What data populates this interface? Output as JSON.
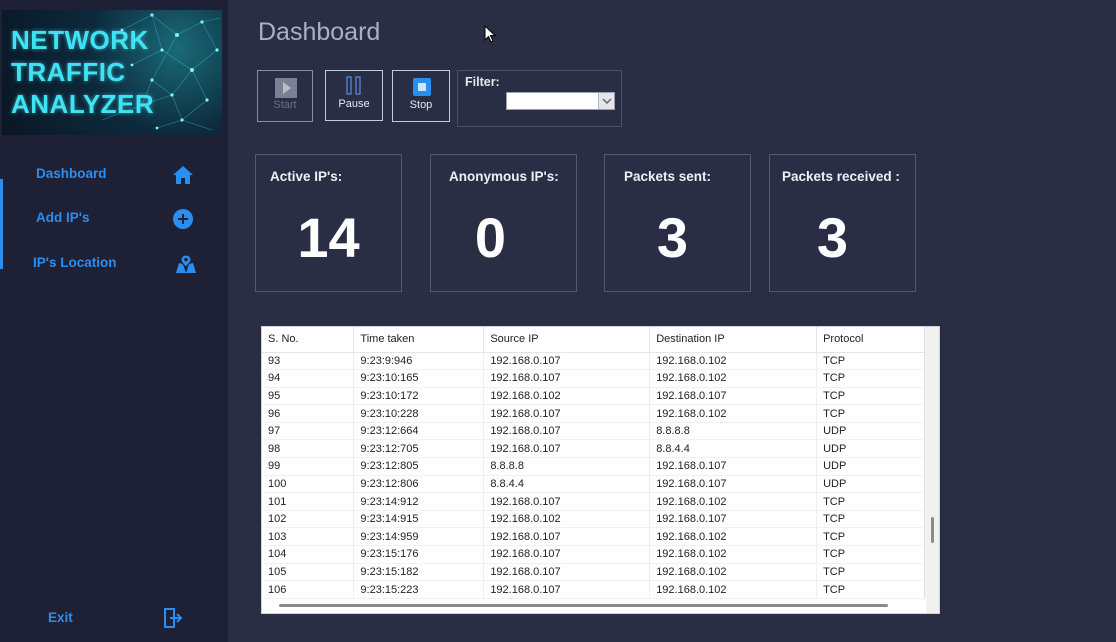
{
  "logo": {
    "lines": [
      "NETWORK",
      "TRAFFIC",
      "ANALYZER"
    ]
  },
  "sidebar": {
    "items": [
      {
        "label": "Dashboard",
        "icon": "home-icon"
      },
      {
        "label": "Add IP's",
        "icon": "plus-circle-icon"
      },
      {
        "label": "IP's Location",
        "icon": "map-location-icon"
      }
    ],
    "exit": {
      "label": "Exit",
      "icon": "exit-door-icon"
    }
  },
  "main": {
    "title": "Dashboard",
    "toolbar": {
      "start_label": "Start",
      "pause_label": "Pause",
      "stop_label": "Stop",
      "filter_label": "Filter:",
      "filter_value": ""
    },
    "stats": [
      {
        "title": "Active IP's:",
        "value": "14"
      },
      {
        "title": "Anonymous IP's:",
        "value": "0"
      },
      {
        "title": "Packets sent:",
        "value": "3"
      },
      {
        "title": "Packets received :",
        "value": "3"
      }
    ]
  },
  "table": {
    "columns": [
      "S. No.",
      "Time taken",
      "Source IP",
      "Destination IP",
      "Protocol"
    ],
    "rows": [
      [
        "93",
        "9:23:9:946",
        "192.168.0.107",
        "192.168.0.102",
        "TCP"
      ],
      [
        "94",
        "9:23:10:165",
        "192.168.0.107",
        "192.168.0.102",
        "TCP"
      ],
      [
        "95",
        "9:23:10:172",
        "192.168.0.102",
        "192.168.0.107",
        "TCP"
      ],
      [
        "96",
        "9:23:10:228",
        "192.168.0.107",
        "192.168.0.102",
        "TCP"
      ],
      [
        "97",
        "9:23:12:664",
        "192.168.0.107",
        "8.8.8.8",
        "UDP"
      ],
      [
        "98",
        "9:23:12:705",
        "192.168.0.107",
        "8.8.4.4",
        "UDP"
      ],
      [
        "99",
        "9:23:12:805",
        "8.8.8.8",
        "192.168.0.107",
        "UDP"
      ],
      [
        "100",
        "9:23:12:806",
        "8.8.4.4",
        "192.168.0.107",
        "UDP"
      ],
      [
        "101",
        "9:23:14:912",
        "192.168.0.107",
        "192.168.0.102",
        "TCP"
      ],
      [
        "102",
        "9:23:14:915",
        "192.168.0.102",
        "192.168.0.107",
        "TCP"
      ],
      [
        "103",
        "9:23:14:959",
        "192.168.0.107",
        "192.168.0.102",
        "TCP"
      ],
      [
        "104",
        "9:23:15:176",
        "192.168.0.107",
        "192.168.0.102",
        "TCP"
      ],
      [
        "105",
        "9:23:15:182",
        "192.168.0.107",
        "192.168.0.102",
        "TCP"
      ],
      [
        "106",
        "9:23:15:223",
        "192.168.0.107",
        "192.168.0.102",
        "TCP"
      ]
    ]
  },
  "colors": {
    "background": "#2a2e45",
    "sidebar": "#1e2036",
    "accent": "#2a8ef0",
    "logo_text": "#3fe4f4"
  }
}
